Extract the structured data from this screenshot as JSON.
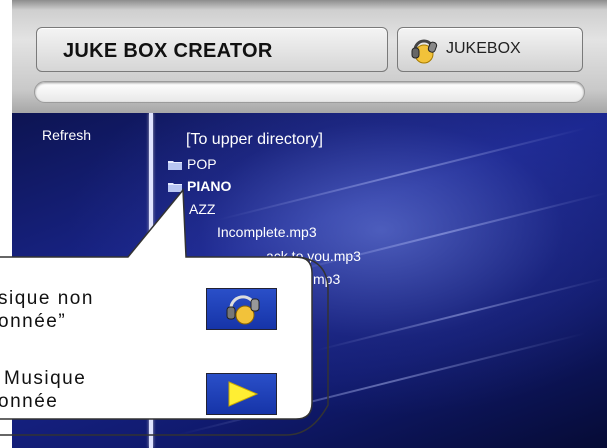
{
  "header": {
    "app_title": "JUKE BOX CREATOR",
    "jukebox_button_label": "JUKEBOX",
    "jukebox_icon": "headphones-icon",
    "progress_fraction": 0
  },
  "sidebar": {
    "refresh_label": "Refresh"
  },
  "file_list": {
    "items": [
      {
        "label": "[To upper directory]",
        "type": "parent"
      },
      {
        "label": "POP",
        "type": "folder"
      },
      {
        "label": "PIANO",
        "type": "folder",
        "selected": true
      },
      {
        "label": "JAZZ",
        "type": "folder",
        "visible_text": "AZZ"
      },
      {
        "label": "Incomplete.mp3",
        "type": "file"
      },
      {
        "label": "ack to you.mp3",
        "type": "file"
      },
      {
        "label": "mp3",
        "type": "file"
      }
    ]
  },
  "callout": {
    "line1": "sique non",
    "line2": "onnée”",
    "line3": "Musique",
    "line4": "onnée",
    "icon_unselected": "headphones-icon",
    "icon_selected": "play-arrow-icon"
  },
  "colors": {
    "panel_dark": "#1a2690",
    "text_light": "#ffffff",
    "play_arrow": "#ffee33"
  }
}
